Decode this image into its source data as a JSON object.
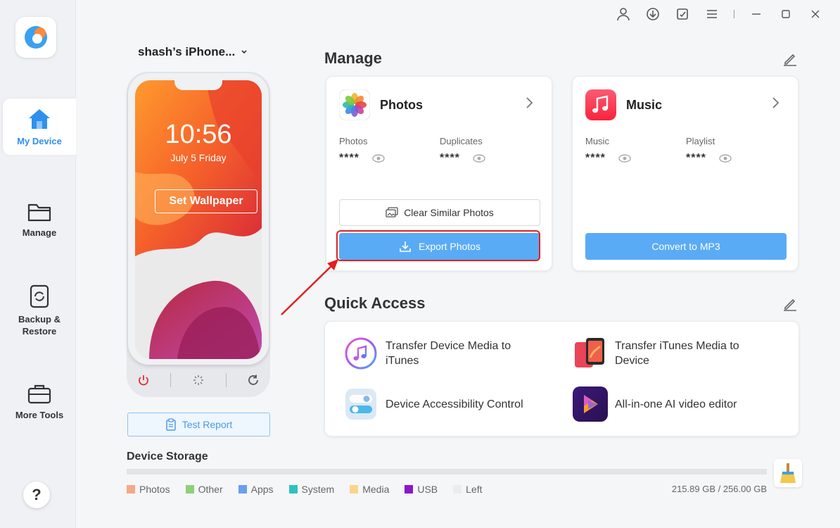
{
  "sidebar": {
    "items": [
      {
        "label": "My Device"
      },
      {
        "label": "Manage"
      },
      {
        "label": "Backup &\nRestore"
      },
      {
        "label": "More Tools"
      }
    ],
    "help": "?"
  },
  "device": {
    "name": "shash’s iPhone...",
    "time": "10:56",
    "date": "July 5 Friday",
    "wallpaper_button": "Set Wallpaper",
    "test_report": "Test Report"
  },
  "manage": {
    "title": "Manage",
    "photos": {
      "title": "Photos",
      "stat1_label": "Photos",
      "stat1_value": "****",
      "stat2_label": "Duplicates",
      "stat2_value": "****",
      "clear_button": "Clear Similar Photos",
      "export_button": "Export Photos"
    },
    "music": {
      "title": "Music",
      "stat1_label": "Music",
      "stat1_value": "****",
      "stat2_label": "Playlist",
      "stat2_value": "****",
      "convert_button": "Convert to MP3"
    }
  },
  "quick_access": {
    "title": "Quick Access",
    "items": [
      {
        "label": "Transfer Device Media to iTunes"
      },
      {
        "label": "Transfer iTunes Media to Device"
      },
      {
        "label": "Device Accessibility Control"
      },
      {
        "label": "All-in-one AI video editor"
      }
    ]
  },
  "storage": {
    "title": "Device Storage",
    "legend": [
      {
        "label": "Photos",
        "color": "#f5a88a"
      },
      {
        "label": "Other",
        "color": "#8fd07a"
      },
      {
        "label": "Apps",
        "color": "#6a9ef0"
      },
      {
        "label": "System",
        "color": "#2cc2c2"
      },
      {
        "label": "Media",
        "color": "#fbd58a"
      },
      {
        "label": "USB",
        "color": "#8a17c9"
      },
      {
        "label": "Left",
        "color": "#ececec"
      }
    ],
    "total": "215.89 GB / 256.00 GB"
  },
  "colors": {
    "accent": "#2f8ff0",
    "button_blue": "#5aabf5",
    "highlight": "#e02020"
  }
}
